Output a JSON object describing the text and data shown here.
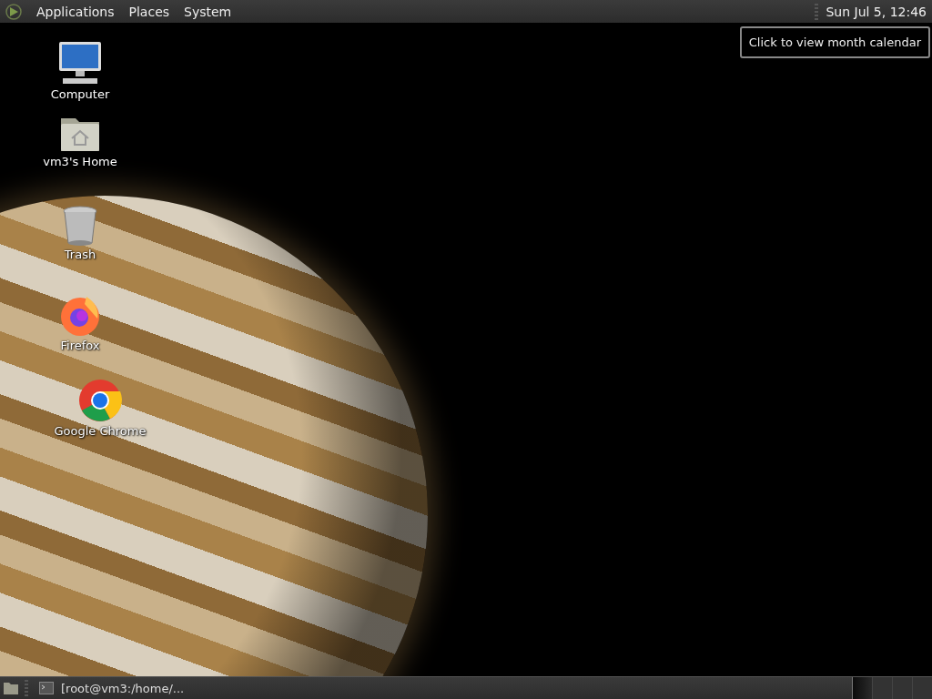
{
  "top_panel": {
    "menus": [
      "Applications",
      "Places",
      "System"
    ],
    "clock": "Sun Jul 5, 12:46"
  },
  "tooltip": "Click to view month calendar",
  "desktop_icons": [
    {
      "kind": "computer",
      "label": "Computer"
    },
    {
      "kind": "home",
      "label": "vm3's Home"
    },
    {
      "kind": "trash",
      "label": "Trash"
    },
    {
      "kind": "firefox",
      "label": "Firefox"
    },
    {
      "kind": "chrome",
      "label": "Google Chrome"
    }
  ],
  "bottom_panel": {
    "tasks": [
      {
        "label": "[root@vm3:/home/...",
        "selected": false
      }
    ],
    "workspaces": [
      {
        "selected": true
      },
      {
        "selected": false
      },
      {
        "selected": false
      },
      {
        "selected": false
      }
    ]
  }
}
